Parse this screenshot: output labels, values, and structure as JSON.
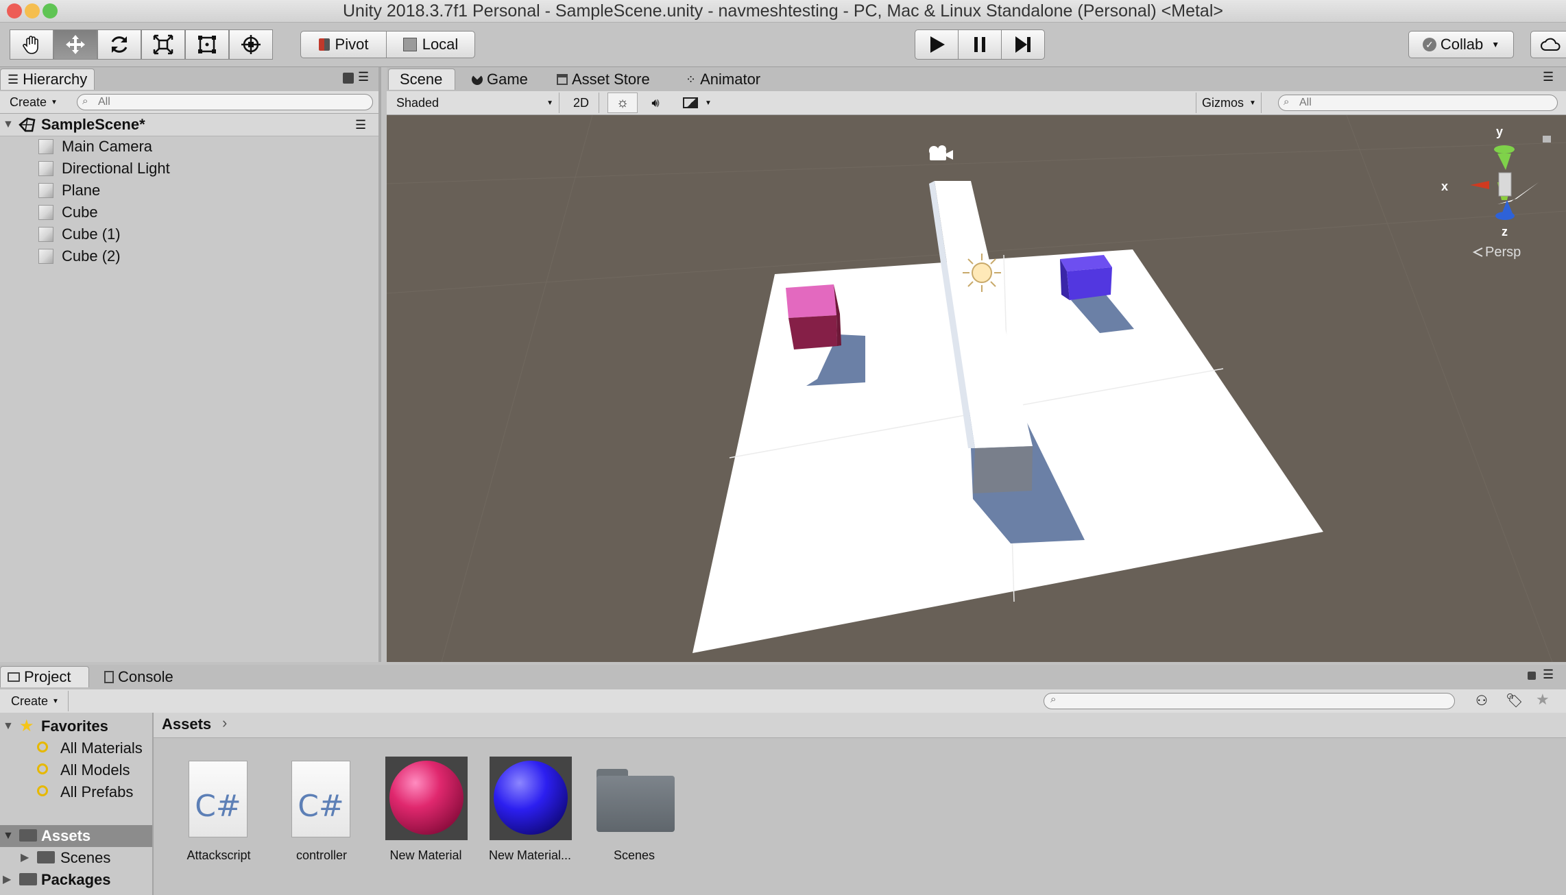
{
  "window": {
    "title": "Unity 2018.3.7f1 Personal - SampleScene.unity - navmeshtesting - PC, Mac & Linux Standalone (Personal) <Metal>",
    "traffic_colors": [
      "#ed5d56",
      "#f5be4f",
      "#5fc454"
    ]
  },
  "toolbar": {
    "tools": [
      "hand-icon",
      "move-icon",
      "rotate-icon",
      "scale-icon",
      "rect-icon",
      "transform-icon"
    ],
    "pivot_label": "Pivot",
    "local_label": "Local",
    "playback": [
      "play-icon",
      "pause-icon",
      "step-icon"
    ],
    "collab_label": "Collab",
    "cloud_icon": "cloud-icon"
  },
  "hierarchy": {
    "tab_label": "Hierarchy",
    "create_label": "Create",
    "search_placeholder": "All",
    "scene_name": "SampleScene*",
    "items": [
      "Main Camera",
      "Directional Light",
      "Plane",
      "Cube",
      "Cube (1)",
      "Cube (2)"
    ]
  },
  "scene": {
    "tabs": [
      {
        "label": "Scene",
        "icon": "grid-icon"
      },
      {
        "label": "Game",
        "icon": "pacman-icon"
      },
      {
        "label": "Asset Store",
        "icon": "store-icon"
      },
      {
        "label": "Animator",
        "icon": "animator-icon"
      }
    ],
    "shading_mode": "Shaded",
    "mode_2d_label": "2D",
    "gizmos_label": "Gizmos",
    "search_placeholder": "All",
    "gizmo_axes": {
      "x": "x",
      "y": "y",
      "z": "z"
    },
    "projection_label": "Persp",
    "colors": {
      "background": "#686057",
      "pink_cube": "#e369bf",
      "blue_cube": "#5237e0",
      "shadow": "#6b80a6"
    }
  },
  "project": {
    "tabs": [
      {
        "label": "Project",
        "icon": "folder-icon"
      },
      {
        "label": "Console",
        "icon": "console-icon"
      }
    ],
    "create_label": "Create",
    "favorites_label": "Favorites",
    "favorites": [
      "All Materials",
      "All Models",
      "All Prefabs"
    ],
    "assets_label": "Assets",
    "asset_children": [
      "Scenes"
    ],
    "packages_label": "Packages",
    "breadcrumb": "Assets",
    "assets": [
      {
        "name": "Attackscript",
        "type": "script",
        "glyph": "C#"
      },
      {
        "name": "controller",
        "type": "script",
        "glyph": "C#"
      },
      {
        "name": "New Material",
        "type": "material",
        "color": "#e0286e"
      },
      {
        "name": "New Material...",
        "type": "material",
        "color": "#2c1ff0"
      },
      {
        "name": "Scenes",
        "type": "folder"
      }
    ]
  }
}
